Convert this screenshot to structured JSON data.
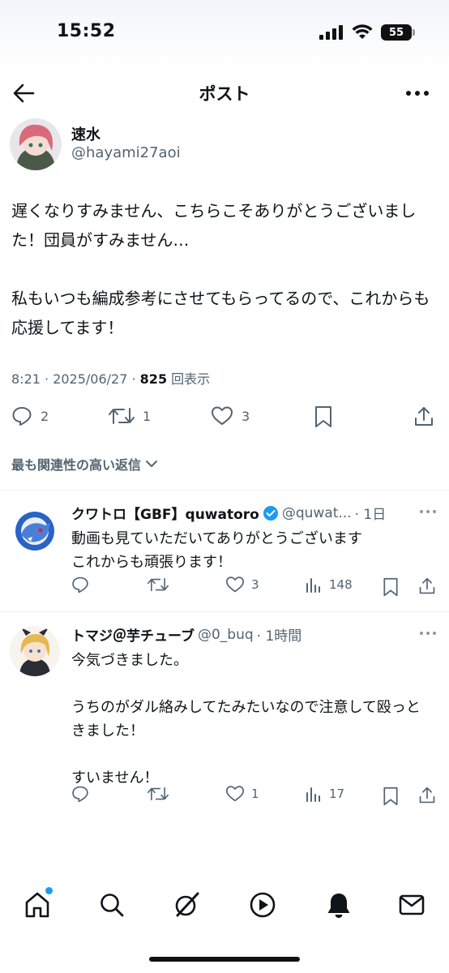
{
  "status": {
    "time": "15:52",
    "battery": "55"
  },
  "nav": {
    "title": "ポスト"
  },
  "post": {
    "name": "速水",
    "handle": "@hayami27aoi",
    "text": "遅くなりすみません、こちらこそありがとうございました！団員がすみません…\n\n私もいつも編成参考にさせてもらってるので、これからも応援してます！",
    "time": "8:21 · 2025/06/27 · ",
    "views": "825",
    "views_label": " 回表示",
    "replies": "2",
    "reposts": "1",
    "likes": "3"
  },
  "sort_label": "最も関連性の高い返信",
  "replies": [
    {
      "name": "クワトロ【GBF】quwatoro",
      "handle": "@quwat...",
      "time": "· 1日",
      "text": "動画も見ていただいてありがとうございます\nこれからも頑張ります！",
      "replies": "",
      "reposts": "",
      "likes": "3",
      "views": "148"
    },
    {
      "name": "トマジ＠芋チューブ",
      "handle": "@0_buq",
      "time": "· 1時間",
      "text": "今気づきました。\n\nうちのがダル絡みしてたみたいなので注意して殴っときました！\n\nすいません！",
      "replies": "",
      "reposts": "",
      "likes": "1",
      "views": "17"
    }
  ],
  "tabs": [
    "home-icon",
    "search-icon",
    "grok-icon",
    "video-icon",
    "notifications-icon",
    "messages-icon"
  ],
  "colors": {
    "accent": "#1d9bf0",
    "muted": "#536471",
    "text": "#0f1419",
    "divider": "#eff3f4"
  }
}
